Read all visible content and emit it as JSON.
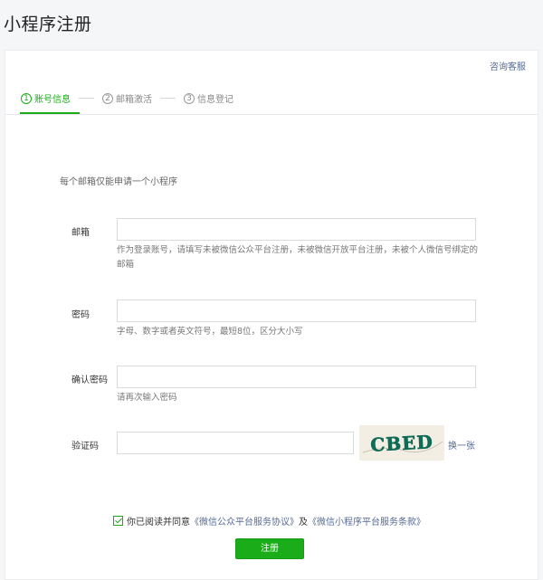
{
  "page_title": "小程序注册",
  "consult_link": "咨询客服",
  "steps": [
    {
      "num": "1",
      "label": "账号信息"
    },
    {
      "num": "2",
      "label": "邮箱激活"
    },
    {
      "num": "3",
      "label": "信息登记"
    }
  ],
  "tip": "每个邮箱仅能申请一个小程序",
  "form": {
    "email_label": "邮箱",
    "email_value": "",
    "email_hint": "作为登录账号，请填写未被微信公众平台注册，未被微信开放平台注册，未被个人微信号绑定的邮箱",
    "password_label": "密码",
    "password_value": "",
    "password_hint": "字母、数字或者英文符号，最短8位，区分大小写",
    "confirm_label": "确认密码",
    "confirm_value": "",
    "confirm_hint": "请再次输入密码",
    "captcha_label": "验证码",
    "captcha_value": "",
    "captcha_text": "CBED",
    "change_link": "换一张"
  },
  "agreement": {
    "prefix": "你已阅读并同意",
    "link1": "《微信公众平台服务协议》",
    "and": "及",
    "link2": "《微信小程序平台服务条款》",
    "checked": true
  },
  "submit_label": "注册",
  "colors": {
    "accent": "#1aad19",
    "link": "#576b95"
  }
}
